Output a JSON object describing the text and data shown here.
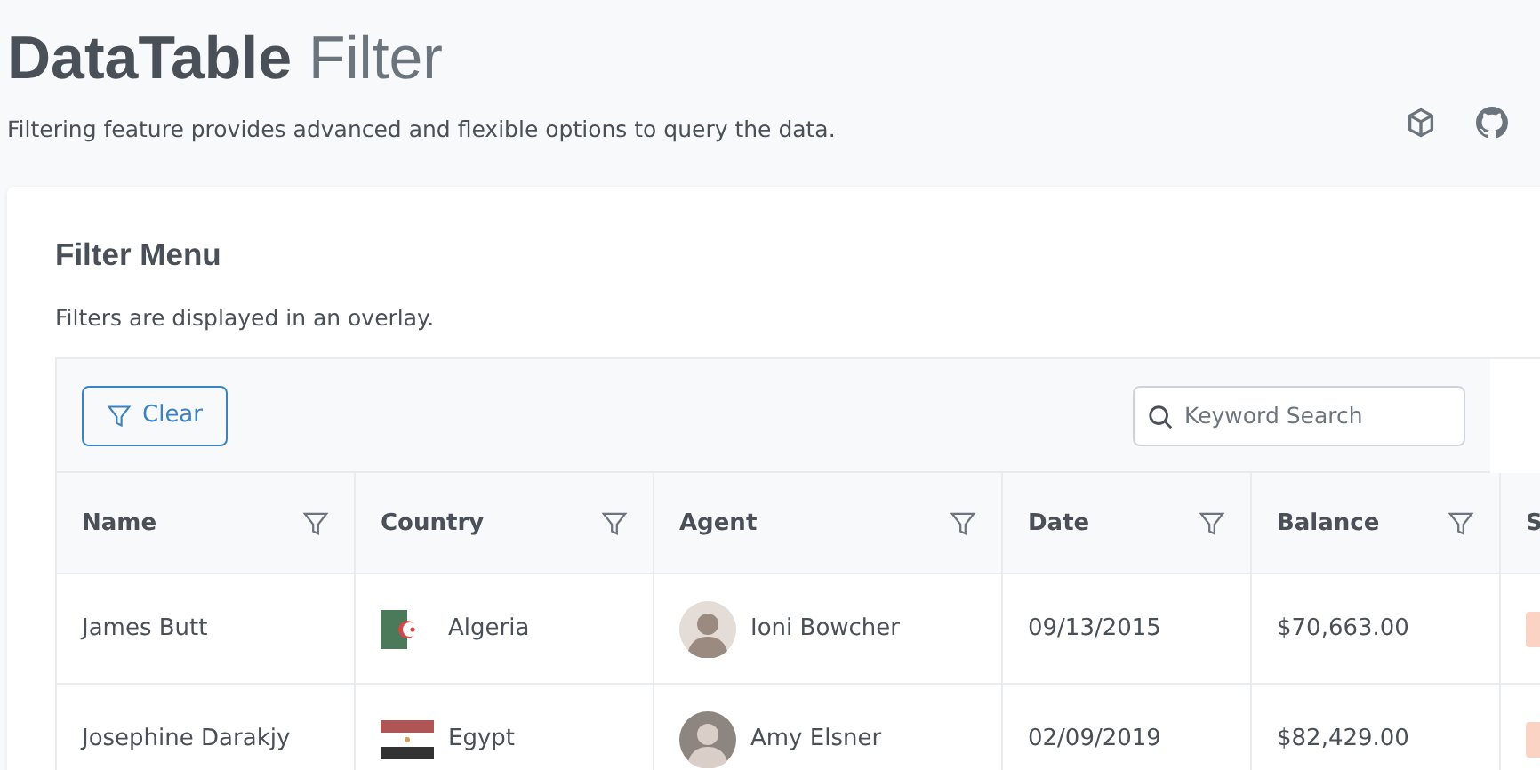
{
  "title": {
    "main": "DataTable",
    "sub": "Filter"
  },
  "description": "Filtering feature provides advanced and flexible options to query the data.",
  "card": {
    "title": "Filter Menu",
    "subtitle": "Filters are displayed in an overlay."
  },
  "toolbar": {
    "clear_label": "Clear",
    "search_placeholder": "Keyword Search"
  },
  "columns": [
    {
      "label": "Name",
      "filter": true
    },
    {
      "label": "Country",
      "filter": true
    },
    {
      "label": "Agent",
      "filter": true
    },
    {
      "label": "Date",
      "filter": true
    },
    {
      "label": "Balance",
      "filter": true
    },
    {
      "label": "S",
      "filter": false
    }
  ],
  "rows": [
    {
      "name": "James Butt",
      "country": {
        "label": "Algeria",
        "kind": "algeria"
      },
      "agent": "Ioni Bowcher",
      "date": "09/13/2015",
      "balance": "$70,663.00"
    },
    {
      "name": "Josephine Darakjy",
      "country": {
        "label": "Egypt",
        "kind": "egypt"
      },
      "agent": "Amy Elsner",
      "date": "02/09/2019",
      "balance": "$82,429.00"
    }
  ]
}
